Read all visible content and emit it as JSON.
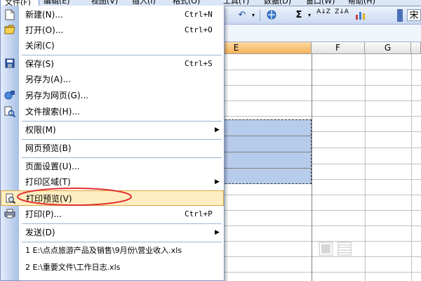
{
  "menubar": {
    "items": [
      {
        "label": "文件(F)"
      },
      {
        "label": "编辑(E)"
      },
      {
        "label": "视图(V)"
      },
      {
        "label": "插入(I)"
      },
      {
        "label": "格式(O)"
      },
      {
        "label": "工具(T)"
      },
      {
        "label": "数据(D)"
      },
      {
        "label": "窗口(W)"
      },
      {
        "label": "帮助(H)"
      }
    ]
  },
  "toolbar": {
    "undo_icon": "↶",
    "sigma_icon": "Σ",
    "sort_asc_label": "A↓Z",
    "sort_desc_label": "Z↓A",
    "chart_icon": "chart-icon",
    "right_text": "宋"
  },
  "columns": {
    "e": "E",
    "f": "F",
    "g": "G"
  },
  "file_menu": {
    "items": [
      {
        "label": "新建(N)...",
        "shortcut": "Ctrl+N",
        "icon": "new-document-icon"
      },
      {
        "label": "打开(O)...",
        "shortcut": "Ctrl+O",
        "icon": "open-folder-icon"
      },
      {
        "label": "关闭(C)"
      },
      {
        "label": "保存(S)",
        "shortcut": "Ctrl+S",
        "icon": "save-icon"
      },
      {
        "label": "另存为(A)..."
      },
      {
        "label": "另存为网页(G)...",
        "icon": "save-web-icon"
      },
      {
        "label": "文件搜索(H)...",
        "icon": "file-search-icon"
      },
      {
        "label": "权限(M)"
      },
      {
        "label": "网页预览(B)"
      },
      {
        "label": "页面设置(U)..."
      },
      {
        "label": "打印区域(T)"
      },
      {
        "label": "打印预览(V)",
        "icon": "print-preview-icon"
      },
      {
        "label": "打印(P)...",
        "shortcut": "Ctrl+P",
        "icon": "printer-icon"
      },
      {
        "label": "发送(D)"
      },
      {
        "label": "1 E:\\点点旅游产品及销售\\9月份\\营业收入.xls"
      },
      {
        "label": "2 E:\\重要文件\\工作日志.xls"
      }
    ]
  },
  "colors": {
    "highlight_fill": "#ffeec2",
    "highlight_border": "#d8a640",
    "annotation_ellipse": "#e03030",
    "selected_range": "#b7cbea",
    "active_column": "#f4b35a"
  }
}
